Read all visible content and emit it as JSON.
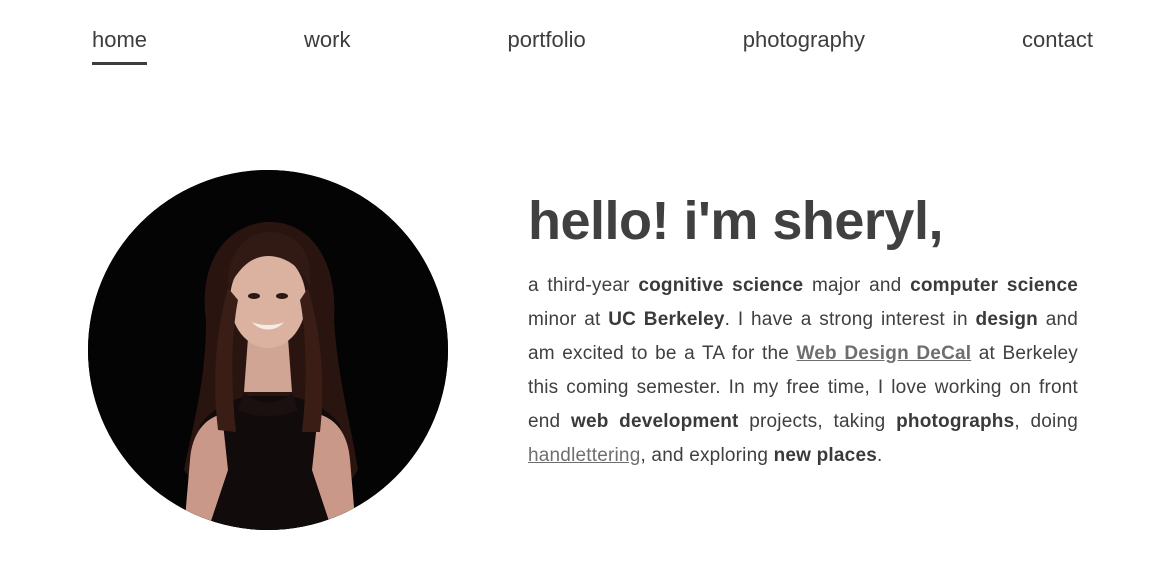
{
  "nav": {
    "items": [
      {
        "label": "home",
        "active": true
      },
      {
        "label": "work",
        "active": false
      },
      {
        "label": "portfolio",
        "active": false
      },
      {
        "label": "photography",
        "active": false
      },
      {
        "label": "contact",
        "active": false
      }
    ]
  },
  "hero": {
    "title": "hello! i'm sheryl,",
    "bio": {
      "p1": "a third-year ",
      "b1": "cognitive science",
      "p2": " major and ",
      "b2": "computer science",
      "p3": " minor at ",
      "b3": "UC Berkeley",
      "p4": ". I have a strong interest in ",
      "b4": "design",
      "p5": " and am excited to be a TA for the ",
      "link1": "Web Design DeCal",
      "p6": " at Berkeley this coming semester. In my free time, I love working on front end ",
      "b5": "web development",
      "p7": " projects, taking ",
      "b6": "photographs",
      "p8": ", doing ",
      "link2": "handlettering",
      "p9": ", and exploring ",
      "b7": "new places",
      "p10": "."
    }
  },
  "colors": {
    "text": "#3f3f3f",
    "link": "#6e6e6e",
    "photo_background": "#050404"
  }
}
